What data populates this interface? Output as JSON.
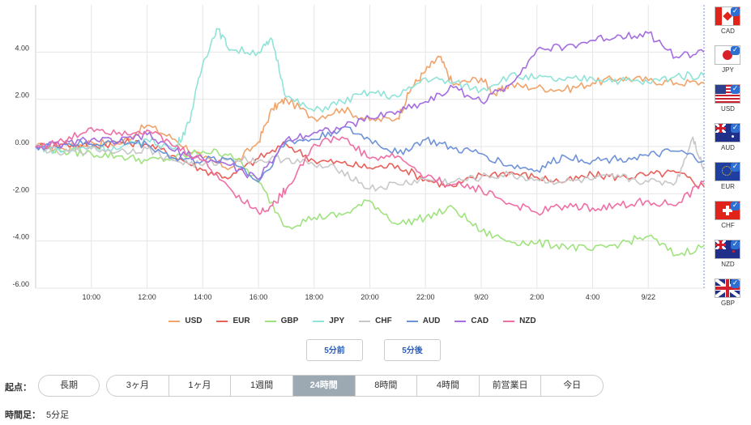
{
  "chart_data": {
    "type": "line",
    "x_ticks": [
      "10:00",
      "12:00",
      "14:00",
      "16:00",
      "18:00",
      "20:00",
      "22:00",
      "9/20",
      "2:00",
      "4:00",
      "9/22"
    ],
    "y_ticks": [
      "4.00",
      "2.00",
      "0.00",
      "-2.00",
      "-4.00",
      "-6.00"
    ],
    "ylim": [
      -6,
      6
    ],
    "xlim": [
      0,
      24
    ],
    "grid": true,
    "legend_position": "bottom",
    "series": [
      {
        "name": "USD",
        "color": "#f0a36a",
        "points": [
          [
            0,
            0
          ],
          [
            1,
            -0.1
          ],
          [
            2,
            0.2
          ],
          [
            3,
            0.1
          ],
          [
            4,
            0.9
          ],
          [
            5,
            0.3
          ],
          [
            6,
            -0.5
          ],
          [
            7,
            -0.9
          ],
          [
            8,
            0.2
          ],
          [
            8.5,
            1.6
          ],
          [
            9,
            2.0
          ],
          [
            10,
            1.2
          ],
          [
            11,
            1.6
          ],
          [
            12,
            1.1
          ],
          [
            13,
            1.2
          ],
          [
            13.5,
            2.5
          ],
          [
            14,
            3.2
          ],
          [
            14.5,
            3.8
          ],
          [
            15,
            2.6
          ],
          [
            16,
            2.9
          ],
          [
            16.5,
            2.2
          ],
          [
            17,
            2.6
          ],
          [
            18,
            2.5
          ],
          [
            19,
            2.4
          ],
          [
            20,
            2.7
          ],
          [
            21,
            2.9
          ],
          [
            22,
            2.8
          ],
          [
            23,
            2.7
          ],
          [
            24,
            2.7
          ]
        ]
      },
      {
        "name": "EUR",
        "color": "#e8605a",
        "points": [
          [
            0,
            0
          ],
          [
            1,
            0.1
          ],
          [
            2,
            0
          ],
          [
            3,
            0.2
          ],
          [
            4,
            0.1
          ],
          [
            5,
            -0.4
          ],
          [
            6,
            -1.0
          ],
          [
            7,
            -1.3
          ],
          [
            8,
            -0.5
          ],
          [
            9,
            0.1
          ],
          [
            10,
            -0.6
          ],
          [
            11,
            -0.7
          ],
          [
            12,
            -0.9
          ],
          [
            13,
            -0.8
          ],
          [
            14,
            -1.4
          ],
          [
            15,
            -1.7
          ],
          [
            16,
            -1.2
          ],
          [
            17,
            -1.1
          ],
          [
            18,
            -1.3
          ],
          [
            19,
            -1.5
          ],
          [
            20,
            -1.2
          ],
          [
            21,
            -1.3
          ],
          [
            22,
            -1.2
          ],
          [
            23,
            -1.1
          ],
          [
            24,
            -1.7
          ]
        ]
      },
      {
        "name": "GBP",
        "color": "#9fe37e",
        "points": [
          [
            0,
            0
          ],
          [
            1,
            -0.2
          ],
          [
            2,
            -0.3
          ],
          [
            3,
            -0.4
          ],
          [
            4,
            -0.6
          ],
          [
            5,
            -0.5
          ],
          [
            6,
            -0.2
          ],
          [
            7,
            -0.3
          ],
          [
            8,
            -1.5
          ],
          [
            9,
            -3.4
          ],
          [
            10,
            -3.0
          ],
          [
            11,
            -2.9
          ],
          [
            12,
            -2.3
          ],
          [
            13,
            -3.3
          ],
          [
            14,
            -3.0
          ],
          [
            15,
            -2.6
          ],
          [
            16,
            -3.6
          ],
          [
            17,
            -4.0
          ],
          [
            18,
            -4.1
          ],
          [
            19,
            -4.2
          ],
          [
            20,
            -4.4
          ],
          [
            21,
            -4.1
          ],
          [
            22,
            -3.8
          ],
          [
            23,
            -4.6
          ],
          [
            24,
            -4.2
          ]
        ]
      },
      {
        "name": "JPY",
        "color": "#8fe3d8",
        "points": [
          [
            0,
            0
          ],
          [
            1,
            -0.2
          ],
          [
            2,
            0
          ],
          [
            3,
            -0.1
          ],
          [
            4,
            0.3
          ],
          [
            5,
            -0.1
          ],
          [
            5.5,
            1.0
          ],
          [
            6,
            3.5
          ],
          [
            6.5,
            5.0
          ],
          [
            7,
            4.1
          ],
          [
            8,
            4.0
          ],
          [
            8.5,
            4.5
          ],
          [
            9,
            2.1
          ],
          [
            10,
            1.5
          ],
          [
            11,
            1.9
          ],
          [
            12,
            2.3
          ],
          [
            13,
            2.1
          ],
          [
            14,
            2.9
          ],
          [
            15,
            2.7
          ],
          [
            16,
            2.4
          ],
          [
            17,
            3.0
          ],
          [
            18,
            2.9
          ],
          [
            19,
            2.8
          ],
          [
            20,
            2.9
          ],
          [
            21,
            2.8
          ],
          [
            22,
            2.7
          ],
          [
            23,
            3.0
          ],
          [
            24,
            3.0
          ]
        ]
      },
      {
        "name": "CHF",
        "color": "#c8c8c8",
        "points": [
          [
            0,
            0
          ],
          [
            1,
            -0.3
          ],
          [
            2,
            -0.1
          ],
          [
            3,
            -0.2
          ],
          [
            4,
            -0.1
          ],
          [
            5,
            -0.6
          ],
          [
            6,
            -0.8
          ],
          [
            7,
            -0.5
          ],
          [
            8,
            -0.6
          ],
          [
            9,
            -0.5
          ],
          [
            10,
            -0.8
          ],
          [
            11,
            -1.0
          ],
          [
            12,
            -1.8
          ],
          [
            13,
            -1.6
          ],
          [
            14,
            -1.4
          ],
          [
            15,
            -1.5
          ],
          [
            16,
            -1.3
          ],
          [
            17,
            -1.2
          ],
          [
            18,
            -1.4
          ],
          [
            19,
            -1.5
          ],
          [
            20,
            -1.4
          ],
          [
            21,
            -1.3
          ],
          [
            22,
            -1.5
          ],
          [
            23,
            -1.5
          ],
          [
            23.6,
            0.4
          ],
          [
            24,
            -1.0
          ]
        ]
      },
      {
        "name": "AUD",
        "color": "#6f93d8",
        "points": [
          [
            0,
            0
          ],
          [
            1,
            0.1
          ],
          [
            2,
            0.1
          ],
          [
            3,
            0.2
          ],
          [
            4,
            0.1
          ],
          [
            5,
            -0.5
          ],
          [
            6,
            -0.6
          ],
          [
            7,
            -0.5
          ],
          [
            8,
            -1.5
          ],
          [
            9,
            0.2
          ],
          [
            10,
            0.3
          ],
          [
            11,
            0.8
          ],
          [
            12,
            0.3
          ],
          [
            13,
            -0.3
          ],
          [
            14,
            0.3
          ],
          [
            15,
            -0.1
          ],
          [
            16,
            -0.3
          ],
          [
            17,
            -0.8
          ],
          [
            18,
            -1.0
          ],
          [
            19,
            -0.4
          ],
          [
            20,
            -0.6
          ],
          [
            21,
            -0.5
          ],
          [
            22,
            -0.4
          ],
          [
            23,
            -0.2
          ],
          [
            24,
            -0.6
          ]
        ]
      },
      {
        "name": "CAD",
        "color": "#a46de0",
        "points": [
          [
            0,
            0
          ],
          [
            1,
            0.1
          ],
          [
            2,
            0.3
          ],
          [
            3,
            0.2
          ],
          [
            4,
            0.5
          ],
          [
            5,
            -0.2
          ],
          [
            6,
            -0.5
          ],
          [
            7,
            -0.8
          ],
          [
            8,
            -1.4
          ],
          [
            9,
            0.3
          ],
          [
            10,
            0.6
          ],
          [
            11,
            0.8
          ],
          [
            12,
            1.2
          ],
          [
            13,
            1.5
          ],
          [
            14,
            1.9
          ],
          [
            15,
            2.5
          ],
          [
            16,
            1.9
          ],
          [
            17,
            2.6
          ],
          [
            18,
            4.1
          ],
          [
            19,
            4.2
          ],
          [
            20,
            4.5
          ],
          [
            21,
            4.7
          ],
          [
            22,
            4.8
          ],
          [
            23,
            3.8
          ],
          [
            24,
            4.0
          ]
        ]
      },
      {
        "name": "NZD",
        "color": "#ef6fa5",
        "points": [
          [
            0,
            0
          ],
          [
            1,
            0.2
          ],
          [
            2,
            0.8
          ],
          [
            3,
            0.6
          ],
          [
            4,
            0.7
          ],
          [
            5,
            0.0
          ],
          [
            6,
            -0.6
          ],
          [
            7,
            -1.8
          ],
          [
            8,
            -2.8
          ],
          [
            8.5,
            -2.5
          ],
          [
            9,
            -1.8
          ],
          [
            10,
            0.1
          ],
          [
            11,
            0.4
          ],
          [
            12,
            -0.5
          ],
          [
            13,
            -0.4
          ],
          [
            14,
            -1.3
          ],
          [
            15,
            -1.6
          ],
          [
            16,
            -1.8
          ],
          [
            17,
            -2.4
          ],
          [
            18,
            -2.8
          ],
          [
            19,
            -2.5
          ],
          [
            20,
            -2.6
          ],
          [
            21,
            -2.5
          ],
          [
            22,
            -2.3
          ],
          [
            23,
            -2.5
          ],
          [
            24,
            -1.5
          ]
        ]
      }
    ]
  },
  "flags": [
    {
      "code": "CAD",
      "icon": "canada-flag-icon"
    },
    {
      "code": "JPY",
      "icon": "japan-flag-icon"
    },
    {
      "code": "USD",
      "icon": "usa-flag-icon"
    },
    {
      "code": "AUD",
      "icon": "australia-flag-icon"
    },
    {
      "code": "EUR",
      "icon": "eu-flag-icon"
    },
    {
      "code": "CHF",
      "icon": "switzerland-flag-icon"
    },
    {
      "code": "NZD",
      "icon": "new-zealand-flag-icon"
    },
    {
      "code": "GBP",
      "icon": "uk-flag-icon"
    }
  ],
  "nav": {
    "prev": "5分前",
    "next": "5分後"
  },
  "origin": {
    "label": "起点：",
    "long": "長期",
    "ranges": [
      "3ヶ月",
      "1ヶ月",
      "1週間",
      "24時間",
      "8時間",
      "4時間",
      "前営業日",
      "今日"
    ],
    "active": "24時間"
  },
  "timeframe": {
    "label": "時間足：",
    "value": "5分足"
  }
}
